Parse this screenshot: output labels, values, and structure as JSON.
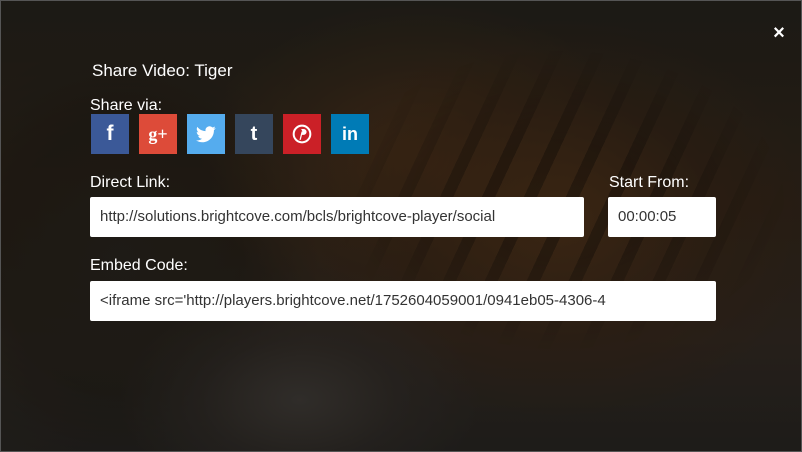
{
  "dialog": {
    "title": "Share Video: Tiger",
    "share_via_label": "Share via:",
    "direct_link_label": "Direct Link:",
    "direct_link_value": "http://solutions.brightcove.com/bcls/brightcove-player/social",
    "start_from_label": "Start From:",
    "start_from_value": "00:00:05",
    "embed_code_label": "Embed Code:",
    "embed_code_value": "<iframe src='http://players.brightcove.net/1752604059001/0941eb05-4306-4",
    "close_glyph": "×"
  },
  "share_buttons": [
    {
      "name": "facebook",
      "glyph": "f",
      "color": "#3b5998"
    },
    {
      "name": "google-plus",
      "glyph": "g+",
      "color": "#dd4b39"
    },
    {
      "name": "twitter",
      "glyph": "🐦",
      "color": "#55acee"
    },
    {
      "name": "tumblr",
      "glyph": "t",
      "color": "#35465c"
    },
    {
      "name": "pinterest",
      "glyph": "ⓟ",
      "color": "#cb2027"
    },
    {
      "name": "linkedin",
      "glyph": "in",
      "color": "#007bb6"
    }
  ]
}
